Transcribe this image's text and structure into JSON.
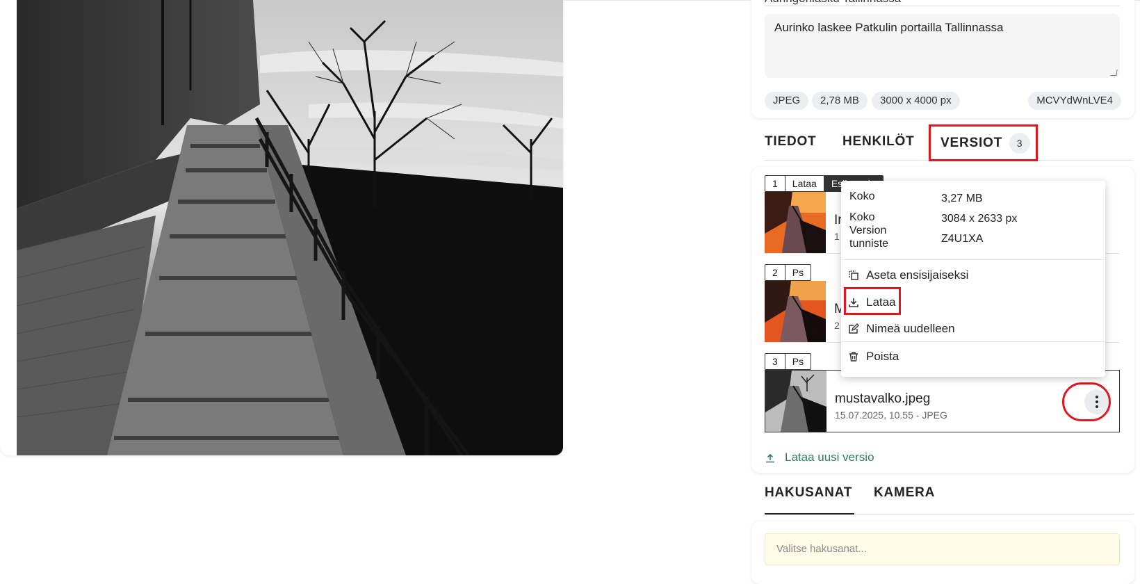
{
  "photo": {
    "alt": "Aurinko laskee Patkulin portailla Tallinnassa"
  },
  "metadata": {
    "title_value": "Auringonlasku Tallinnassa",
    "description_value": "Aurinko laskee Patkulin portailla Tallinnassa",
    "chips": {
      "format": "JPEG",
      "size": "2,78 MB",
      "dimensions": "3000 x 4000 px",
      "id": "MCVYdWnLVE4"
    }
  },
  "tabs": {
    "info": "TIEDOT",
    "people": "HENKILÖT",
    "versions": "VERSIOT",
    "versions_count": "3"
  },
  "versions": [
    {
      "number": "1",
      "tag": "Lataa",
      "extra_tag": "Esikatselu",
      "name": "Ir",
      "meta": "1"
    },
    {
      "number": "2",
      "tag": "Ps",
      "name": "M",
      "meta": "2"
    },
    {
      "number": "3",
      "tag": "Ps",
      "name": "mustavalko.jpeg",
      "meta": "15.07.2025, 10.55 - JPEG"
    }
  ],
  "context_menu": {
    "size_label": "Koko",
    "size_value": "3,27 MB",
    "dims_label": "Koko",
    "dims_value": "3084 x 2633 px",
    "id_label_line1": "Version",
    "id_label_line2": "tunniste",
    "id_value": "Z4U1XA",
    "set_primary": "Aseta ensisijaiseksi",
    "download": "Lataa",
    "rename": "Nimeä uudelleen",
    "delete": "Poista"
  },
  "upload_new_version": "Lataa uusi versio",
  "lower_tabs": {
    "keywords": "HAKUSANAT",
    "camera": "KAMERA"
  },
  "keywords_placeholder": "Valitse hakusanat...",
  "colors": {
    "highlight": "#e0171f",
    "link_green": "#2e7d61",
    "keyword_bg": "#fffbe6"
  }
}
